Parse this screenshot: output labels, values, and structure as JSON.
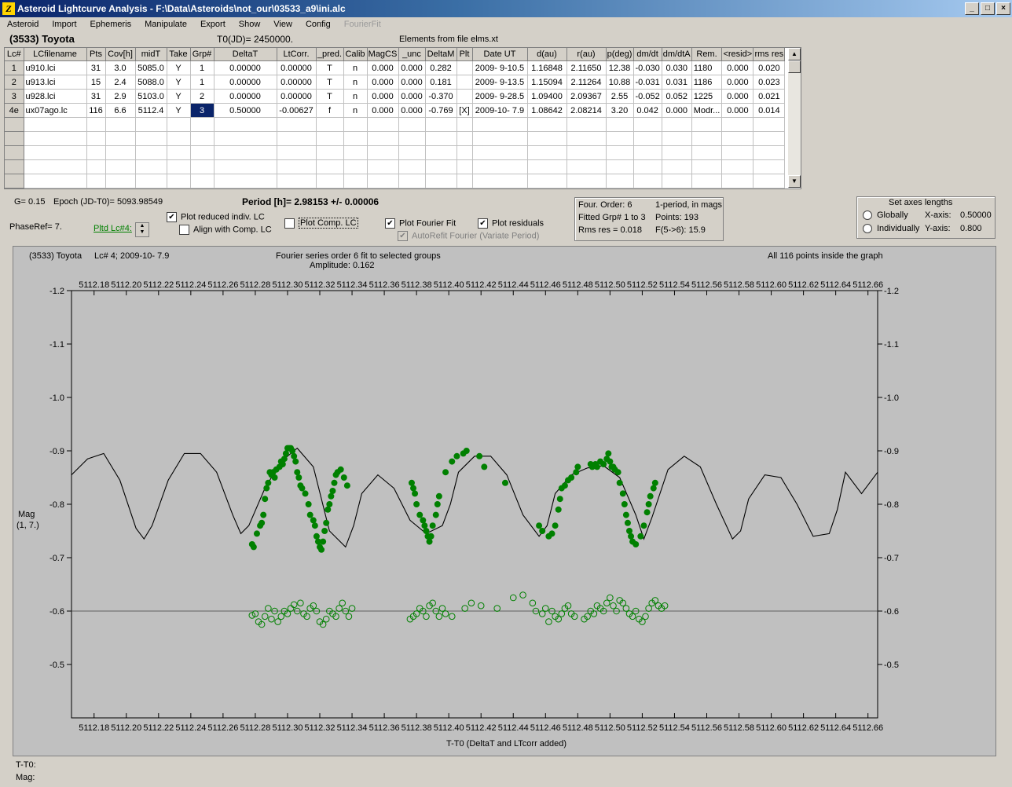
{
  "window": {
    "title": "Asteroid Lightcurve Analysis - F:\\Data\\Asteroids\\not_our\\03533_a9\\ini.alc",
    "icon_glyph": "Z",
    "buttons": [
      "_",
      "3",
      "X"
    ]
  },
  "menu": [
    "Asteroid",
    "Import",
    "Ephemeris",
    "Manipulate",
    "Export",
    "Show",
    "View",
    "Config",
    "FourierFit"
  ],
  "header": {
    "asteroid": "(3533) Toyota",
    "t0": "T0(JD)= 2450000.",
    "elements": "Elements from file elms.xt"
  },
  "table": {
    "columns": [
      "Lc#",
      "LCfilename",
      "Pts",
      "Cov[h]",
      "midT",
      "Take",
      "Grp#",
      "DeltaT",
      "LtCorr.",
      "_pred.",
      "Calib",
      "MagCS",
      "_unc",
      "DeltaM",
      "Plt",
      "Date UT",
      "d(au)",
      "r(au)",
      "p(deg)",
      "dm/dt",
      "dm/dtA",
      "Rem.",
      "<resid>",
      "rms res"
    ],
    "rows": [
      [
        "1",
        "u910.lci",
        "31",
        "3.0",
        "5085.0",
        "Y",
        "1",
        "0.00000",
        "0.00000",
        "T",
        "n",
        "0.000",
        "0.000",
        "0.282",
        "",
        "2009- 9-10.5",
        "1.16848",
        "2.11650",
        "12.38",
        "-0.030",
        "0.030",
        "1180",
        "0.000",
        "0.020"
      ],
      [
        "2",
        "u913.lci",
        "15",
        "2.4",
        "5088.0",
        "Y",
        "1",
        "0.00000",
        "0.00000",
        "T",
        "n",
        "0.000",
        "0.000",
        "0.181",
        "",
        "2009- 9-13.5",
        "1.15094",
        "2.11264",
        "10.88",
        "-0.031",
        "0.031",
        "1186",
        "0.000",
        "0.023"
      ],
      [
        "3",
        "u928.lci",
        "31",
        "2.9",
        "5103.0",
        "Y",
        "2",
        "0.00000",
        "0.00000",
        "T",
        "n",
        "0.000",
        "0.000",
        "-0.370",
        "",
        "2009- 9-28.5",
        "1.09400",
        "2.09367",
        "2.55",
        "-0.052",
        "0.052",
        "1225",
        "0.000",
        "0.021"
      ],
      [
        "4e",
        "ux07ago.lc",
        "116",
        "6.6",
        "5112.4",
        "Y",
        "3",
        "0.50000",
        "-0.00627",
        "f",
        "n",
        "0.000",
        "0.000",
        "-0.769",
        "[X]",
        "2009-10- 7.9",
        "1.08642",
        "2.08214",
        "3.20",
        "0.042",
        "0.000",
        "Modr...",
        "0.000",
        "0.014"
      ]
    ],
    "empty_rows": 5
  },
  "info": {
    "g": "G= 0.15",
    "epoch": "Epoch (JD-T0)= 5093.98549",
    "period": "Period [h]= 2.98153 +/- 0.00006",
    "phaseref": "PhaseRef= 7.",
    "pltd_lc": "Pltd Lc#4:",
    "plot_reduced": "Plot reduced indiv. LC",
    "align_comp": "Align with Comp. LC",
    "plot_comp": "Plot Comp. LC",
    "plot_fourier": "Plot Fourier Fit",
    "plot_residuals": "Plot residuals",
    "autorefit": "AutoRefit Fourier (Variate Period)"
  },
  "fourier_box": {
    "order": "Four. Order:  6",
    "one_period": "1-period, in mags",
    "fitted": "Fitted Grp# 1 to 3",
    "points": "Points: 193",
    "rms": "Rms res     = 0.018",
    "ftest": "F(5->6):  15.9"
  },
  "axes_box": {
    "title": "Set axes lengths",
    "globally": "Globally",
    "individually": "Individually",
    "xaxis_label": "X-axis:",
    "xaxis_value": "0.50000",
    "yaxis_label": "Y-axis:",
    "yaxis_value": "0.800"
  },
  "status": {
    "t_t0": "T-T0:",
    "mag": "Mag:"
  },
  "chart_data": {
    "type": "scatter",
    "header_left": "(3533) Toyota",
    "header_lc": "Lc# 4; 2009-10- 7.9",
    "title": "Fourier series order 6 fit to selected groups",
    "subtitle": "Amplitude: 0.162",
    "header_right": "All 116 points inside the graph",
    "xlabel": "T-T0 (DeltaT and LTcorr added)",
    "ylabel": "Mag",
    "ylabel2": "(1, 7.)",
    "xlim": [
      5112.166,
      5112.666
    ],
    "ylim": [
      -1.2,
      -0.4
    ],
    "y_inverted": true,
    "x_ticks": [
      "5112.18",
      "5112.20",
      "5112.22",
      "5112.24",
      "5112.26",
      "5112.28",
      "5112.30",
      "5112.32",
      "5112.34",
      "5112.36",
      "5112.38",
      "5112.40",
      "5112.42",
      "5112.44",
      "5112.46",
      "5112.48",
      "5112.50",
      "5112.52",
      "5112.54",
      "5112.56",
      "5112.58",
      "5112.60",
      "5112.62",
      "5112.64",
      "5112.66"
    ],
    "y_ticks": [
      "-1.2",
      "-1.1",
      "-1.0",
      "-0.9",
      "-0.8",
      "-0.7",
      "-0.6",
      "-0.5"
    ],
    "residual_baseline": -0.6,
    "colors": {
      "points": "#008000",
      "fit": "#000000",
      "background": "#c0c0c0"
    },
    "fit_curve": {
      "x": [
        5112.166,
        5112.176,
        5112.186,
        5112.196,
        5112.206,
        5112.211,
        5112.216,
        5112.226,
        5112.236,
        5112.246,
        5112.256,
        5112.266,
        5112.271,
        5112.276,
        5112.286,
        5112.296,
        5112.306,
        5112.316,
        5112.321,
        5112.326,
        5112.336,
        5112.341,
        5112.346,
        5112.356,
        5112.366,
        5112.376,
        5112.386,
        5112.396,
        5112.401,
        5112.406,
        5112.416,
        5112.426,
        5112.436,
        5112.446,
        5112.456,
        5112.461,
        5112.466,
        5112.476,
        5112.486,
        5112.496,
        5112.506,
        5112.516,
        5112.521,
        5112.526,
        5112.536,
        5112.546,
        5112.556,
        5112.566,
        5112.576,
        5112.581,
        5112.586,
        5112.596,
        5112.606,
        5112.616,
        5112.626,
        5112.636,
        5112.641,
        5112.646,
        5112.656,
        5112.666
      ],
      "y": [
        -0.855,
        -0.885,
        -0.895,
        -0.845,
        -0.755,
        -0.735,
        -0.76,
        -0.845,
        -0.895,
        -0.895,
        -0.86,
        -0.78,
        -0.745,
        -0.76,
        -0.83,
        -0.88,
        -0.905,
        -0.87,
        -0.81,
        -0.75,
        -0.72,
        -0.76,
        -0.82,
        -0.855,
        -0.83,
        -0.77,
        -0.745,
        -0.76,
        -0.8,
        -0.86,
        -0.89,
        -0.89,
        -0.855,
        -0.78,
        -0.74,
        -0.76,
        -0.82,
        -0.855,
        -0.868,
        -0.872,
        -0.85,
        -0.78,
        -0.735,
        -0.775,
        -0.865,
        -0.89,
        -0.87,
        -0.8,
        -0.735,
        -0.75,
        -0.81,
        -0.855,
        -0.85,
        -0.8,
        -0.74,
        -0.745,
        -0.79,
        -0.86,
        -0.82,
        -0.86
      ]
    },
    "points": {
      "x": [
        5112.278,
        5112.279,
        5112.281,
        5112.283,
        5112.284,
        5112.285,
        5112.286,
        5112.287,
        5112.288,
        5112.289,
        5112.29,
        5112.291,
        5112.292,
        5112.293,
        5112.295,
        5112.296,
        5112.297,
        5112.298,
        5112.299,
        5112.3,
        5112.301,
        5112.302,
        5112.303,
        5112.304,
        5112.305,
        5112.306,
        5112.307,
        5112.308,
        5112.309,
        5112.311,
        5112.313,
        5112.314,
        5112.316,
        5112.317,
        5112.318,
        5112.319,
        5112.32,
        5112.321,
        5112.322,
        5112.323,
        5112.324,
        5112.325,
        5112.326,
        5112.327,
        5112.328,
        5112.329,
        5112.33,
        5112.331,
        5112.333,
        5112.335,
        5112.337,
        5112.377,
        5112.378,
        5112.379,
        5112.38,
        5112.382,
        5112.384,
        5112.385,
        5112.386,
        5112.387,
        5112.388,
        5112.389,
        5112.39,
        5112.392,
        5112.393,
        5112.394,
        5112.398,
        5112.402,
        5112.405,
        5112.409,
        5112.411,
        5112.419,
        5112.422,
        5112.435,
        5112.456,
        5112.458,
        5112.462,
        5112.464,
        5112.466,
        5112.468,
        5112.469,
        5112.47,
        5112.472,
        5112.474,
        5112.476,
        5112.479,
        5112.48,
        5112.488,
        5112.489,
        5112.491,
        5112.492,
        5112.494,
        5112.496,
        5112.498,
        5112.499,
        5112.5,
        5112.501,
        5112.502,
        5112.503,
        5112.505,
        5112.506,
        5112.508,
        5112.509,
        5112.51,
        5112.511,
        5112.512,
        5112.513,
        5112.514,
        5112.516,
        5112.519,
        5112.521,
        5112.523,
        5112.524,
        5112.525,
        5112.527,
        5112.528
      ],
      "y": [
        -0.725,
        -0.72,
        -0.745,
        -0.76,
        -0.765,
        -0.78,
        -0.81,
        -0.83,
        -0.84,
        -0.86,
        -0.855,
        -0.86,
        -0.85,
        -0.865,
        -0.87,
        -0.88,
        -0.875,
        -0.885,
        -0.895,
        -0.905,
        -0.905,
        -0.905,
        -0.9,
        -0.89,
        -0.88,
        -0.86,
        -0.85,
        -0.835,
        -0.83,
        -0.82,
        -0.8,
        -0.78,
        -0.77,
        -0.76,
        -0.74,
        -0.73,
        -0.72,
        -0.715,
        -0.73,
        -0.75,
        -0.765,
        -0.79,
        -0.8,
        -0.815,
        -0.825,
        -0.84,
        -0.855,
        -0.86,
        -0.865,
        -0.85,
        -0.835,
        -0.84,
        -0.83,
        -0.82,
        -0.8,
        -0.78,
        -0.77,
        -0.76,
        -0.75,
        -0.74,
        -0.73,
        -0.74,
        -0.76,
        -0.78,
        -0.8,
        -0.815,
        -0.86,
        -0.88,
        -0.89,
        -0.895,
        -0.9,
        -0.89,
        -0.87,
        -0.84,
        -0.76,
        -0.75,
        -0.74,
        -0.745,
        -0.76,
        -0.79,
        -0.81,
        -0.83,
        -0.835,
        -0.845,
        -0.85,
        -0.86,
        -0.87,
        -0.875,
        -0.87,
        -0.875,
        -0.87,
        -0.88,
        -0.875,
        -0.885,
        -0.895,
        -0.88,
        -0.87,
        -0.87,
        -0.865,
        -0.86,
        -0.84,
        -0.82,
        -0.8,
        -0.78,
        -0.765,
        -0.75,
        -0.74,
        -0.73,
        -0.725,
        -0.74,
        -0.76,
        -0.785,
        -0.8,
        -0.815,
        -0.83,
        -0.84
      ]
    },
    "residuals": {
      "x": [
        5112.278,
        5112.28,
        5112.282,
        5112.284,
        5112.286,
        5112.288,
        5112.29,
        5112.292,
        5112.294,
        5112.296,
        5112.298,
        5112.3,
        5112.302,
        5112.304,
        5112.306,
        5112.308,
        5112.31,
        5112.312,
        5112.314,
        5112.316,
        5112.318,
        5112.32,
        5112.322,
        5112.324,
        5112.326,
        5112.328,
        5112.33,
        5112.332,
        5112.334,
        5112.336,
        5112.338,
        5112.34,
        5112.376,
        5112.378,
        5112.38,
        5112.382,
        5112.384,
        5112.386,
        5112.388,
        5112.39,
        5112.392,
        5112.394,
        5112.396,
        5112.398,
        5112.402,
        5112.41,
        5112.414,
        5112.42,
        5112.43,
        5112.44,
        5112.446,
        5112.452,
        5112.454,
        5112.458,
        5112.46,
        5112.462,
        5112.464,
        5112.466,
        5112.468,
        5112.47,
        5112.472,
        5112.474,
        5112.476,
        5112.478,
        5112.484,
        5112.486,
        5112.488,
        5112.49,
        5112.492,
        5112.494,
        5112.496,
        5112.498,
        5112.5,
        5112.502,
        5112.504,
        5112.506,
        5112.508,
        5112.51,
        5112.512,
        5112.514,
        5112.516,
        5112.518,
        5112.52,
        5112.522,
        5112.524,
        5112.526,
        5112.528,
        5112.53,
        5112.532,
        5112.534
      ],
      "y": [
        -0.592,
        -0.595,
        -0.58,
        -0.575,
        -0.59,
        -0.605,
        -0.585,
        -0.6,
        -0.58,
        -0.59,
        -0.6,
        -0.595,
        -0.605,
        -0.612,
        -0.6,
        -0.615,
        -0.595,
        -0.59,
        -0.605,
        -0.61,
        -0.6,
        -0.58,
        -0.575,
        -0.585,
        -0.6,
        -0.595,
        -0.59,
        -0.605,
        -0.615,
        -0.6,
        -0.59,
        -0.605,
        -0.585,
        -0.59,
        -0.595,
        -0.605,
        -0.6,
        -0.59,
        -0.61,
        -0.615,
        -0.6,
        -0.59,
        -0.605,
        -0.595,
        -0.59,
        -0.605,
        -0.615,
        -0.61,
        -0.605,
        -0.625,
        -0.63,
        -0.615,
        -0.6,
        -0.595,
        -0.605,
        -0.58,
        -0.6,
        -0.59,
        -0.585,
        -0.595,
        -0.605,
        -0.61,
        -0.595,
        -0.59,
        -0.585,
        -0.59,
        -0.6,
        -0.595,
        -0.61,
        -0.605,
        -0.6,
        -0.615,
        -0.625,
        -0.61,
        -0.6,
        -0.62,
        -0.615,
        -0.605,
        -0.595,
        -0.59,
        -0.6,
        -0.585,
        -0.58,
        -0.59,
        -0.605,
        -0.615,
        -0.62,
        -0.61,
        -0.605,
        -0.61
      ]
    }
  }
}
